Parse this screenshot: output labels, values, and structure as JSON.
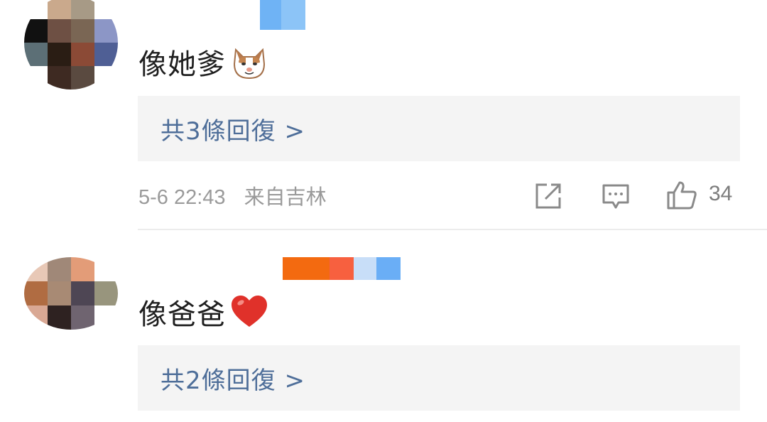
{
  "comments": [
    {
      "text": "像她爹",
      "emoji": "cat-face-emoji",
      "replies_label": "共3條回復 >",
      "timestamp": "5-6 22:43",
      "location": "来自吉林",
      "likes": "34",
      "avatar_colors": [
        "#ffffff",
        "#caa98c",
        "#a79a86",
        "#ffffff",
        "#111111",
        "#6e5044",
        "#7a6654",
        "#8c96c6",
        "#5c6f76",
        "#2a1d14",
        "#8b4a36",
        "#4f5f95",
        "#ffffff",
        "#3e2a22",
        "#5a4a40",
        "#ffffff"
      ],
      "badge_colors": [
        "#6fb3f5",
        "#8cc4f7"
      ]
    },
    {
      "text": "像爸爸",
      "emoji": "red-heart-emoji",
      "replies_label": "共2條回復 >",
      "avatar_colors": [
        "#e8c8b6",
        "#a08878",
        "#e39c78",
        "#ffffff",
        "#b06c42",
        "#a88a74",
        "#4e4654",
        "#98957d",
        "#d9a894",
        "#2e2221",
        "#6f6470",
        "#ffffff"
      ],
      "badge_colors": [
        "#f36a10",
        "#f7603f",
        "#c8def8",
        "#6aaef6"
      ]
    }
  ],
  "accent_color": "#4e6e99"
}
